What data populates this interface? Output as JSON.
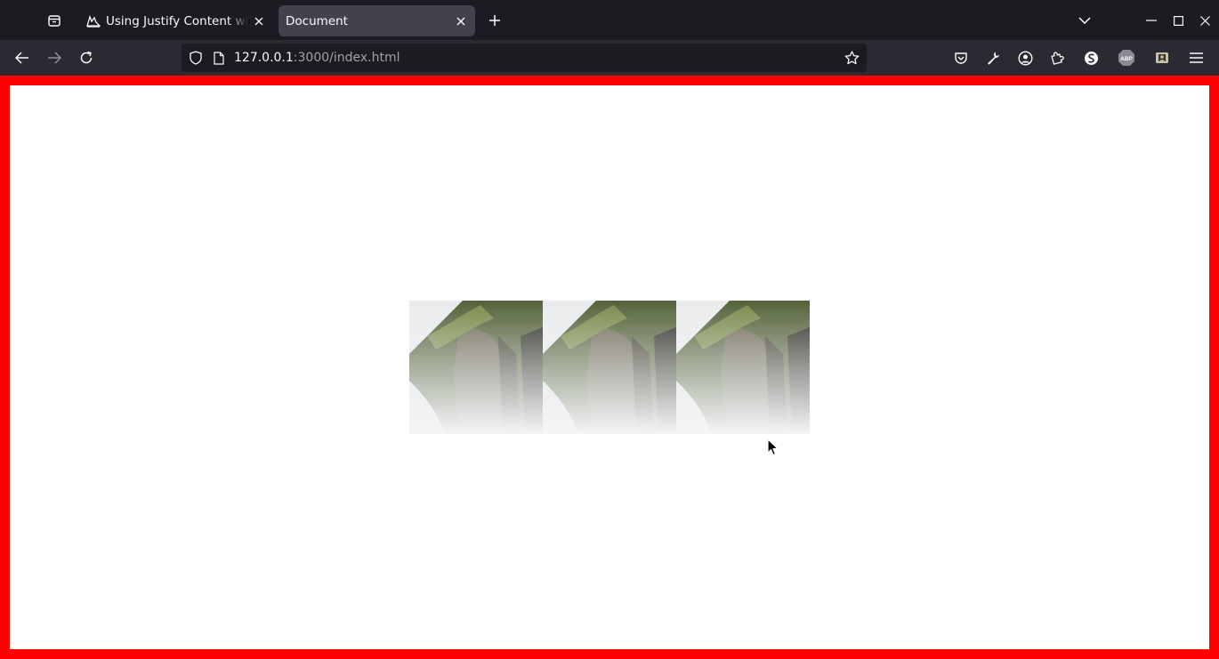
{
  "browser": {
    "tabs": [
      {
        "title": "Using Justify Content with",
        "active": false
      },
      {
        "title": "Document",
        "active": true
      }
    ],
    "url": {
      "host": "127.0.0.1",
      "path": ":3000/index.html"
    }
  },
  "page": {
    "border_color": "#ff0000",
    "background": "#ffffff",
    "images": [
      {
        "alt": "misty cliff"
      },
      {
        "alt": "misty cliff"
      },
      {
        "alt": "misty cliff"
      }
    ]
  },
  "icons": {
    "tab_manager": "tab-manager-icon",
    "new_tab": "plus-icon",
    "list_all_tabs": "chevron-down-icon",
    "back": "back-arrow-icon",
    "forward": "forward-arrow-icon",
    "reload": "reload-icon",
    "shield": "shield-icon",
    "page": "page-icon",
    "bookmark": "star-icon",
    "pocket": "pocket-icon",
    "tools": "wrench-icon",
    "account": "account-icon",
    "extensions": "puzzle-icon",
    "sync": "sync-icon",
    "adblock": "abp-icon",
    "extension2": "extension-icon",
    "menu": "hamburger-menu-icon"
  }
}
